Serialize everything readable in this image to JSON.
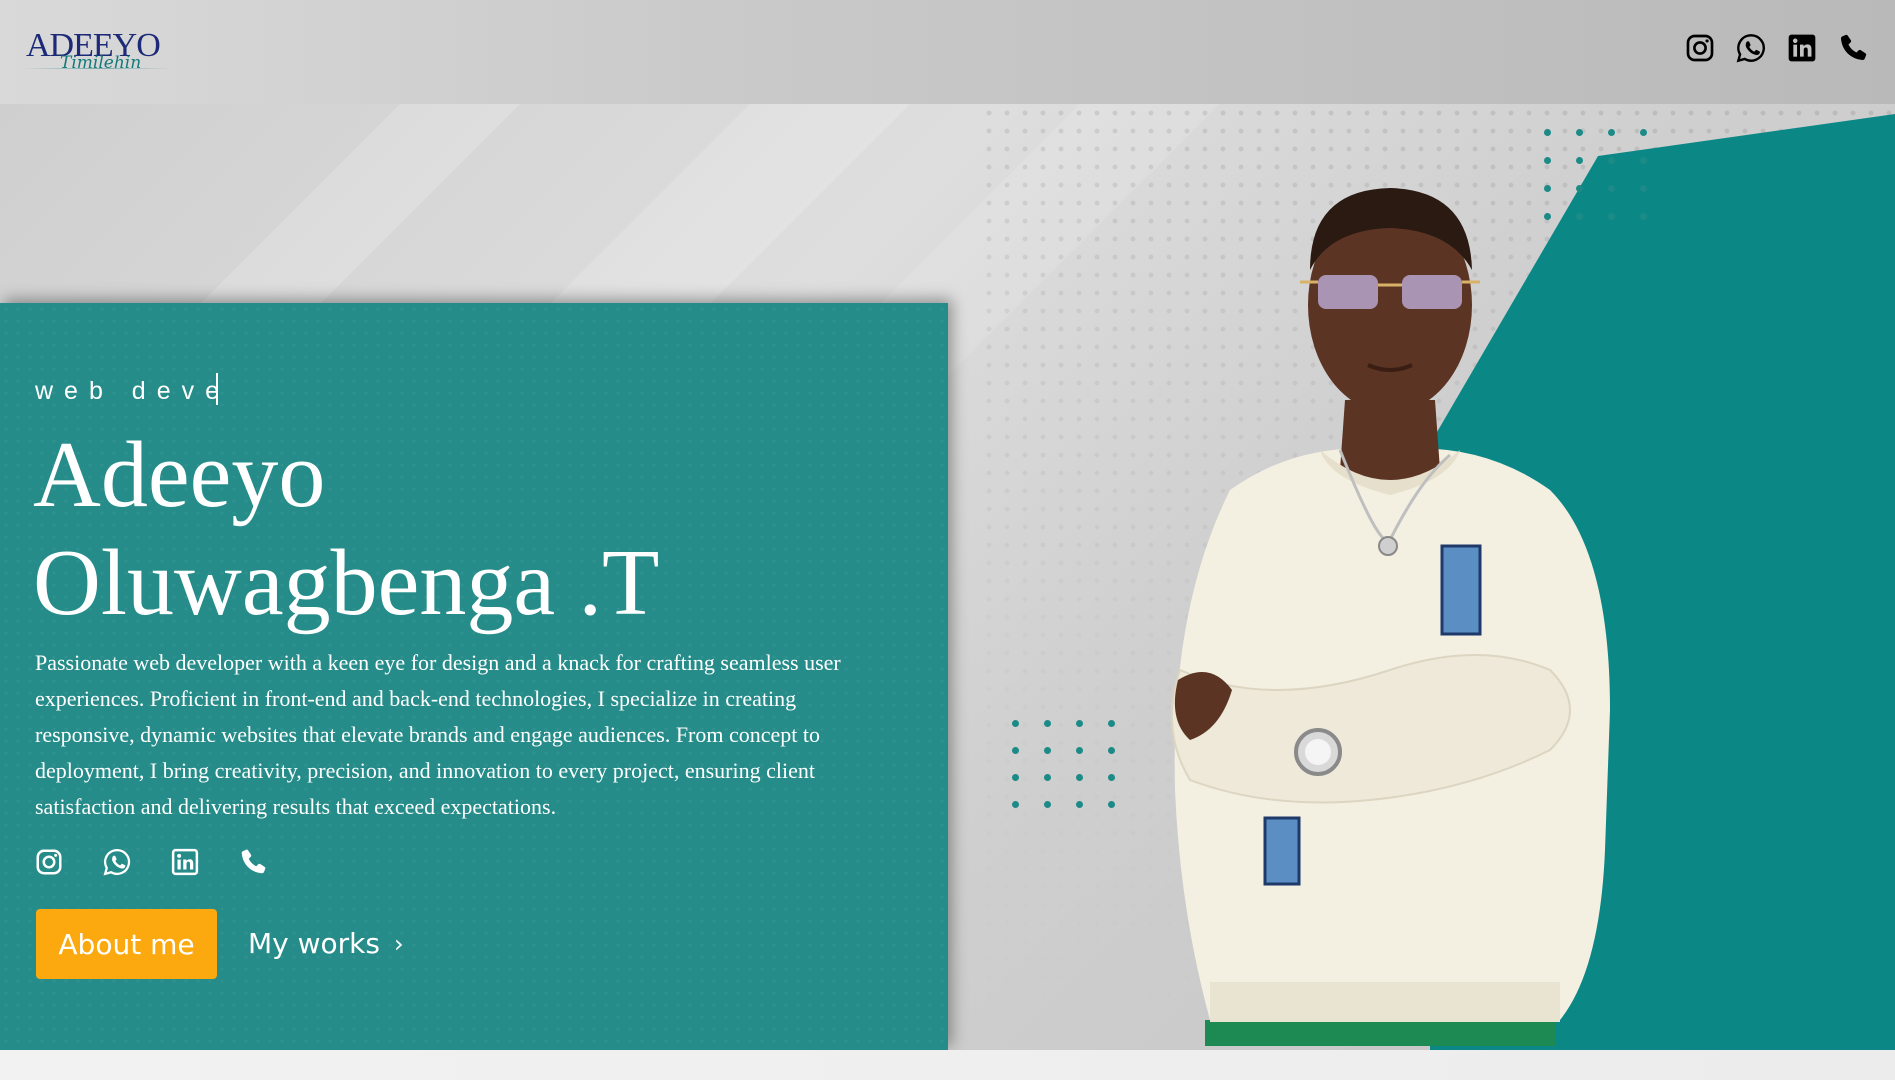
{
  "header": {
    "logo": {
      "title": "ADEEYO",
      "script": "Timilehin"
    },
    "icons": [
      "instagram-icon",
      "whatsapp-icon",
      "linkedin-icon",
      "phone-icon"
    ]
  },
  "hero": {
    "role_typing": "web deve",
    "name_line1": "Adeeyo",
    "name_line2": "Oluwagbenga .T",
    "bio": "Passionate web developer with a keen eye for design and a knack for crafting seamless user experiences. Proficient in front-end and back-end technologies, I specialize in creating responsive, dynamic websites that elevate brands and engage audiences. From concept to deployment, I bring creativity, precision, and innovation to every project, ensuring client satisfaction and delivering results that exceed expectations.",
    "about_button": "About me",
    "works_link": "My works",
    "works_chevron": "›"
  },
  "colors": {
    "teal": "#258c89",
    "accent": "#fca90f",
    "logo_navy": "#1c2a78"
  }
}
